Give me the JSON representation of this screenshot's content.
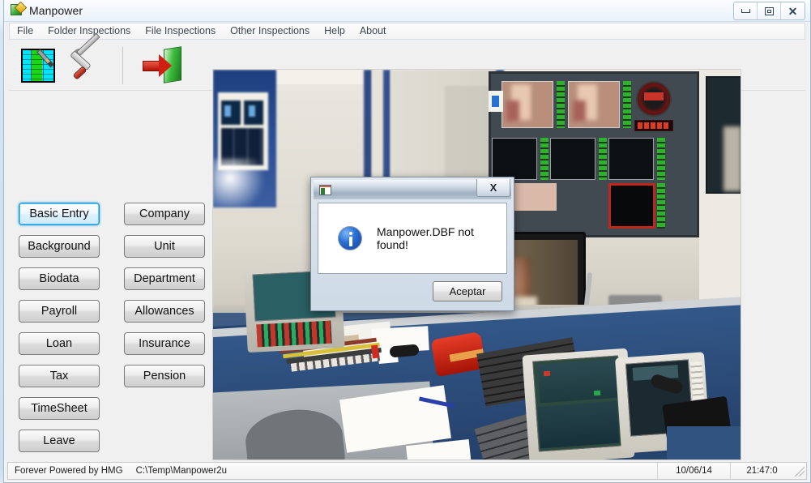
{
  "window": {
    "title": "Manpower",
    "icon": "spreadsheet-pencil-icon",
    "controls": {
      "minimize": "minimize-icon",
      "maximize": "maximize-icon",
      "close": "close-icon"
    }
  },
  "menu": {
    "items": [
      {
        "label": "File"
      },
      {
        "label": "Folder Inspections"
      },
      {
        "label": "File Inspections"
      },
      {
        "label": "Other Inspections"
      },
      {
        "label": "Help"
      },
      {
        "label": "About"
      }
    ]
  },
  "toolbar": {
    "buttons": [
      {
        "name": "edit-records-icon",
        "tooltip": "Edit Records"
      },
      {
        "name": "tools-icon",
        "tooltip": "Tools"
      },
      {
        "name": "exit-icon",
        "tooltip": "Exit"
      }
    ]
  },
  "button_panel": {
    "left_column": [
      {
        "label": "Basic Entry",
        "focused": true
      },
      {
        "label": "Background",
        "focused": false
      },
      {
        "label": "Biodata",
        "focused": false
      },
      {
        "label": "Payroll",
        "focused": false
      },
      {
        "label": "Loan",
        "focused": false
      },
      {
        "label": "Tax",
        "focused": false
      },
      {
        "label": "TimeSheet",
        "focused": false
      },
      {
        "label": "Leave",
        "focused": false
      }
    ],
    "right_column": [
      {
        "label": "Company",
        "focused": false
      },
      {
        "label": "Unit",
        "focused": false
      },
      {
        "label": "Department",
        "focused": false
      },
      {
        "label": "Allowances",
        "focused": false
      },
      {
        "label": "Insurance",
        "focused": false
      },
      {
        "label": "Pension",
        "focused": false
      }
    ]
  },
  "photo": {
    "description": "Broadcast television control room with monitor wall, blue desk, keyboards, red telephone and CRT monitors"
  },
  "dialog": {
    "title": "",
    "icon": "window-icon",
    "close_label": "X",
    "message_icon": "info-icon",
    "message": "Manpower.DBF not found!",
    "accept_label": "Aceptar"
  },
  "status_bar": {
    "powered": "Forever Powered by HMG",
    "path": "C:\\Temp\\Manpower2u",
    "date": "10/06/14",
    "time": "21:47:0",
    "grip": "resize-grip-icon"
  },
  "colors": {
    "focus_blue": "#1a8fd6",
    "panel_gray": "#f0f0f0",
    "title_light": "#f2f7fc",
    "info_blue": "#2a6fd4"
  }
}
